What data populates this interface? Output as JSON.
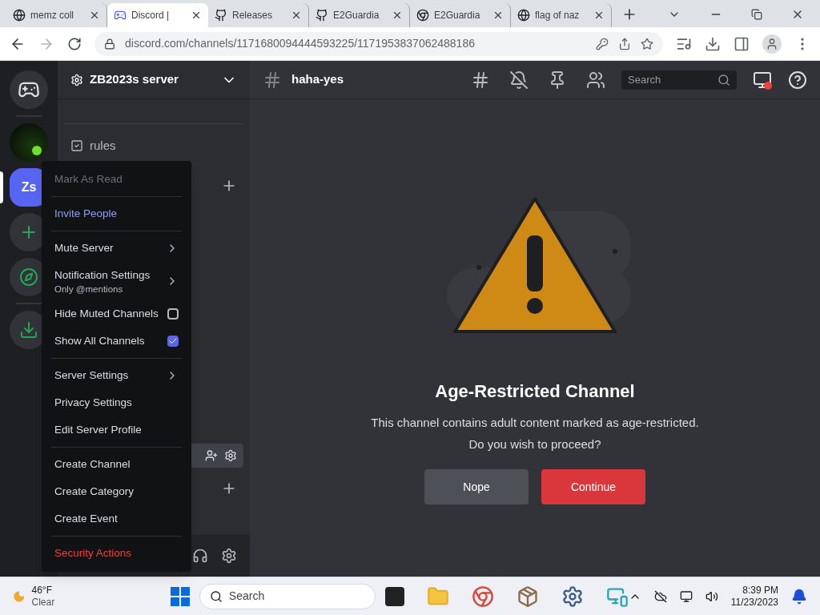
{
  "browser": {
    "tabs": [
      {
        "title": "memz coll",
        "selected": false
      },
      {
        "title": "Discord |",
        "selected": true
      },
      {
        "title": "Releases",
        "selected": false
      },
      {
        "title": "E2Guardia",
        "selected": false
      },
      {
        "title": "E2Guardia",
        "selected": false
      },
      {
        "title": "flag of naz",
        "selected": false
      }
    ],
    "url": "discord.com/channels/1171680094444593225/1171953837062488186"
  },
  "servers": [
    {
      "kind": "home",
      "selected": false
    },
    {
      "kind": "image",
      "selected": false
    },
    {
      "kind": "initials",
      "label": "Zs",
      "selected": true
    },
    {
      "kind": "add",
      "selected": false
    },
    {
      "kind": "explore",
      "selected": false
    },
    {
      "kind": "download",
      "selected": false
    }
  ],
  "sidebar": {
    "server_name": "ZB2023s server",
    "channels": [
      {
        "name": "rules"
      }
    ]
  },
  "menu": {
    "groups": [
      [
        {
          "label": "Mark As Read",
          "kind": "action",
          "color": "#6d6f78"
        }
      ],
      [
        {
          "label": "Invite People",
          "kind": "action",
          "color": "#949cf7"
        }
      ],
      [
        {
          "label": "Mute Server",
          "kind": "submenu",
          "color": "#dbdee1"
        },
        {
          "label": "Notification Settings",
          "subtitle": "Only @mentions",
          "kind": "submenu",
          "color": "#dbdee1"
        },
        {
          "label": "Hide Muted Channels",
          "kind": "checkbox",
          "checked": false,
          "color": "#dbdee1"
        },
        {
          "label": "Show All Channels",
          "kind": "checkbox",
          "checked": true,
          "color": "#dbdee1"
        }
      ],
      [
        {
          "label": "Server Settings",
          "kind": "submenu",
          "color": "#dbdee1"
        },
        {
          "label": "Privacy Settings",
          "kind": "action",
          "color": "#dbdee1"
        },
        {
          "label": "Edit Server Profile",
          "kind": "action",
          "color": "#dbdee1"
        }
      ],
      [
        {
          "label": "Create Channel",
          "kind": "action",
          "color": "#dbdee1"
        },
        {
          "label": "Create Category",
          "kind": "action",
          "color": "#dbdee1"
        },
        {
          "label": "Create Event",
          "kind": "action",
          "color": "#dbdee1"
        }
      ],
      [
        {
          "label": "Security Actions",
          "kind": "action",
          "color": "#f23f42"
        }
      ]
    ]
  },
  "channel": {
    "name": "haha-yes",
    "search_placeholder": "Search"
  },
  "gate": {
    "title": "Age-Restricted Channel",
    "message": "This channel contains adult content marked as age-restricted.",
    "question": "Do you wish to proceed?",
    "buttons": [
      {
        "label": "Nope",
        "kind": "secondary"
      },
      {
        "label": "Continue",
        "kind": "danger"
      }
    ]
  },
  "taskbar": {
    "temperature": "46°F",
    "condition": "Clear",
    "search_placeholder": "Search",
    "time": "8:39 PM",
    "date": "11/23/2023"
  }
}
